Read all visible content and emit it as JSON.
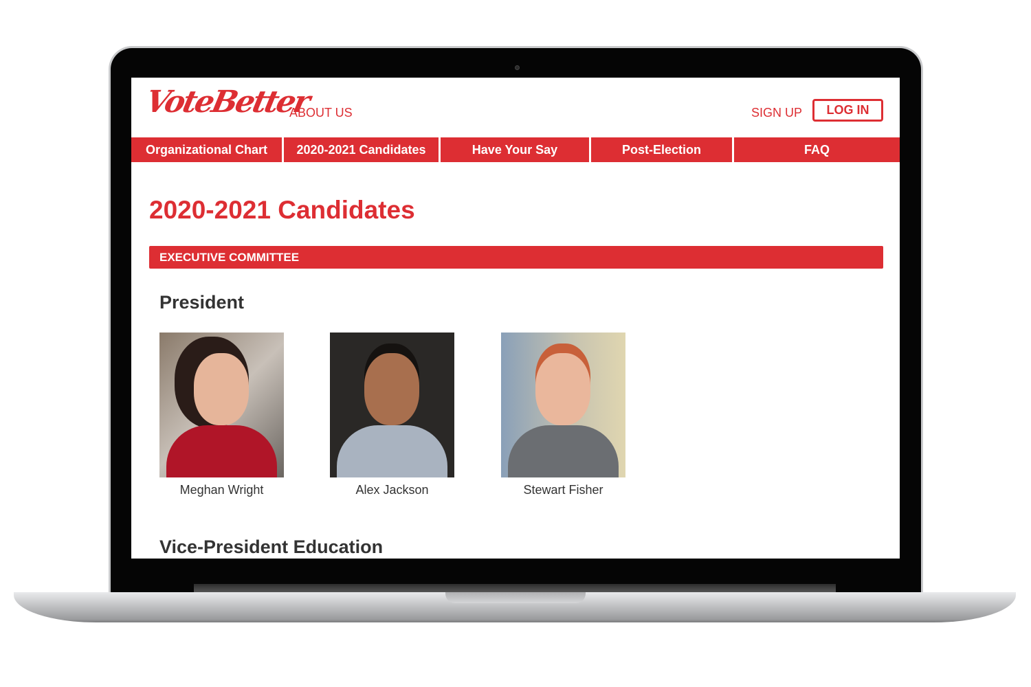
{
  "header": {
    "logo": "VoteBetter",
    "about": "ABOUT US",
    "signup": "SIGN UP",
    "login": "LOG IN"
  },
  "nav": [
    "Organizational Chart",
    "2020-2021 Candidates",
    "Have Your Say",
    "Post-Election",
    "FAQ"
  ],
  "page_title": "2020-2021 Candidates",
  "section": "EXECUTIVE COMMITTEE",
  "roles": [
    "President",
    "Vice-President Education"
  ],
  "candidates": [
    {
      "name": "Meghan Wright"
    },
    {
      "name": "Alex Jackson"
    },
    {
      "name": "Stewart Fisher"
    }
  ],
  "colors": {
    "accent": "#dd2e33"
  }
}
